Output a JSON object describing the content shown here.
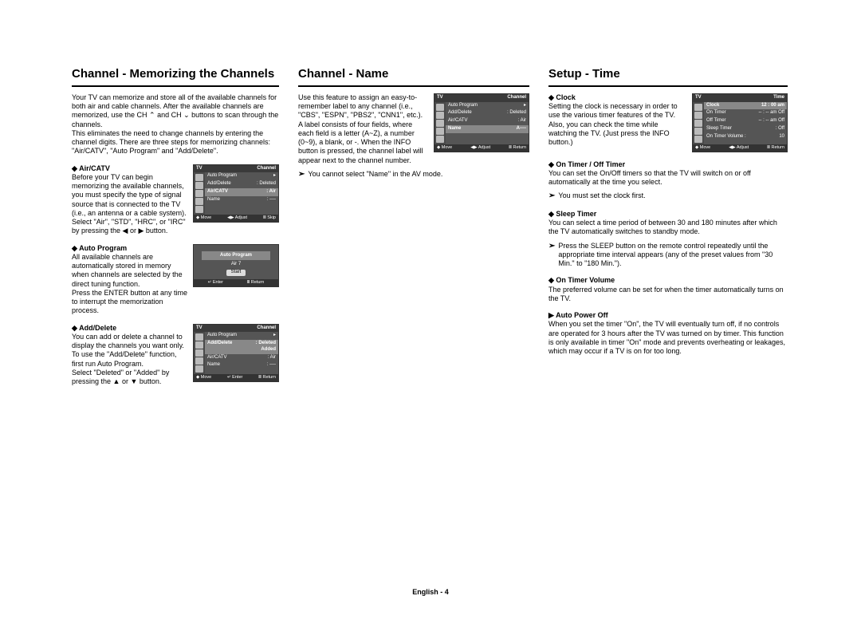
{
  "footer": "English - 4",
  "col1": {
    "heading": "Channel - Memorizing the Channels",
    "intro": "Your TV can memorize and store all of the available channels for both air and cable channels. After the available channels are memorized, use the CH ⌃ and CH ⌄ buttons to scan through the channels.\nThis eliminates the need to change channels by entering the channel digits. There are three steps for memorizing channels: \"Air/CATV\", \"Auto Program\" and \"Add/Delete\".",
    "aircatv": {
      "title": "Air/CATV",
      "body": "Before your TV can begin memorizing the available channels, you must specify the type of signal source that is connected to the TV (i.e., an antenna or a cable system). Select \"Air\", \"STD\", \"HRC\", or \"IRC\" by pressing the ◀ or ▶ button."
    },
    "autoprogram": {
      "title": "Auto Program",
      "body": "All available channels are automatically stored in memory when channels are selected by the direct tuning function.\nPress the ENTER button at any time to interrupt the memorization process."
    },
    "adddelete": {
      "title": "Add/Delete",
      "body": "You can add or delete a channel to display the channels you want only. To use the \"Add/Delete\" function, first run Auto Program.\nSelect \"Deleted\" or \"Added\" by pressing the ▲ or ▼ button."
    }
  },
  "col2": {
    "heading": "Channel - Name",
    "body": "Use this feature to assign an easy-to-remember label to any channel (i.e., \"CBS\", \"ESPN\", \"PBS2\", \"CNN1\", etc.).\nA label consists of four fields, where each field is a letter (A~Z), a number (0~9), a blank, or -. When the INFO button is pressed, the channel label will appear next to the channel number.",
    "note": "You cannot select \"Name\" in the AV mode."
  },
  "col3": {
    "heading": "Setup - Time",
    "clock": {
      "title": "Clock",
      "body": "Setting the clock is necessary in order to use the various timer features of the TV. Also, you can check the time while watching the TV. (Just press the INFO button.)"
    },
    "onoff": {
      "title": "On Timer / Off Timer",
      "body": "You can set the On/Off timers so that the TV will switch on or off automatically at the time you select.",
      "note": "You must set the clock first."
    },
    "sleep": {
      "title": "Sleep Timer",
      "body": "You can select a time period of between 30 and 180 minutes after which the TV automatically switches to standby mode.",
      "note": "Press the SLEEP button on the remote control repeatedly until the appropriate time interval appears (any of the preset values from \"30 Min.\" to \"180 Min.\")."
    },
    "vol": {
      "title": "On Timer Volume",
      "body": "The preferred volume can be set for when the timer automatically turns on the TV."
    },
    "auto": {
      "title": "Auto Power Off",
      "body": "When you set the timer \"On\", the TV will eventually turn off, if no controls are operated for 3 hours after the TV was turned on by timer. This function is only available in timer \"On\" mode and prevents overheating or leakages, which may occur if a TV is on for too long."
    }
  },
  "osd_channel": {
    "tv": "TV",
    "title": "Channel",
    "r1": "Auto Program",
    "r1v": "▸",
    "r2": "Add/Delete",
    "r2v": ": Deleted",
    "r3": "Air/CATV",
    "r3v": ": Air",
    "r4": "Name",
    "r4v": ": ----",
    "f1": "◆ Move",
    "f2": "◀▶ Adjust",
    "f3": "Ⅲ Skip"
  },
  "osd_auto": {
    "title": "Auto Program",
    "air": "Air     7",
    "start": "Start",
    "f1": "↵ Enter",
    "f2": "Ⅲ Return"
  },
  "osd_name": {
    "tv": "TV",
    "title": "Channel",
    "r1": "Auto Program",
    "r1v": "▸",
    "r2": "Add/Delete",
    "r2v": ": Deleted",
    "r3": "Air/CATV",
    "r3v": ": Air",
    "r4": "Name",
    "r4v": "A----",
    "f1": "◆ Move",
    "f2": "◀▶ Adjust",
    "f3": "Ⅲ Return"
  },
  "osd_add": {
    "tv": "TV",
    "title": "Channel",
    "r1": "Auto Program",
    "r1v": "▸",
    "r2": "Add/Delete",
    "r2v": ": Deleted\nAdded",
    "r3": "Air/CATV",
    "r3v": ": Air",
    "r4": "Name",
    "r4v": ": ----",
    "f1": "◆ Move",
    "f2": "↵ Enter",
    "f3": "Ⅲ Return"
  },
  "osd_time": {
    "tv": "TV",
    "title": "Time",
    "r1": "Clock",
    "r1v": "12 : 00 am",
    "r2": "On Timer",
    "r2v": "-- : --  am  Off",
    "r3": "Off Timer",
    "r3v": "-- : --  am  Off",
    "r4": "Sleep Timer",
    "r4v": ": Off",
    "r5": "On Timer Volume :",
    "r5v": "10",
    "f1": "◆ Move",
    "f2": "◀▶ Adjust",
    "f3": "Ⅲ Return"
  }
}
